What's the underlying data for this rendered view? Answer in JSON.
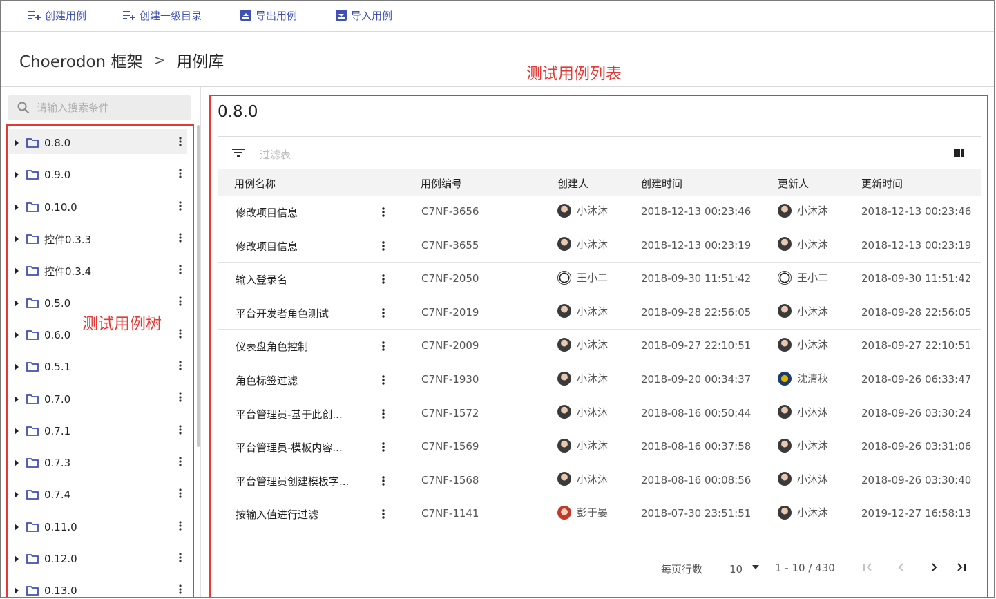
{
  "toolbar": {
    "create_case": "创建用例",
    "create_root_dir": "创建一级目录",
    "export_case": "导出用例",
    "import_case": "导入用例"
  },
  "breadcrumb": {
    "project": "Choerodon 框架",
    "separator": ">",
    "current": "用例库"
  },
  "annotations": {
    "list": "测试用例列表",
    "tree": "测试用例树"
  },
  "search": {
    "placeholder": "请输入搜索条件"
  },
  "tree": {
    "items": [
      {
        "label": "0.8.0",
        "selected": true
      },
      {
        "label": "0.9.0"
      },
      {
        "label": "0.10.0"
      },
      {
        "label": "控件0.3.3"
      },
      {
        "label": "控件0.3.4"
      },
      {
        "label": "0.5.0"
      },
      {
        "label": "0.6.0"
      },
      {
        "label": "0.5.1"
      },
      {
        "label": "0.7.0"
      },
      {
        "label": "0.7.1"
      },
      {
        "label": "0.7.3"
      },
      {
        "label": "0.7.4"
      },
      {
        "label": "0.11.0"
      },
      {
        "label": "0.12.0"
      },
      {
        "label": "0.13.0"
      }
    ]
  },
  "main": {
    "title": "0.8.0",
    "filter_placeholder": "过滤表",
    "columns": [
      "用例名称",
      "用例编号",
      "创建人",
      "创建时间",
      "更新人",
      "更新时间"
    ],
    "rows": [
      {
        "name": "修改项目信息",
        "code": "C7NF-3656",
        "creator": "小沐沐",
        "created": "2018-12-13 00:23:46",
        "updater": "小沐沐",
        "updated": "2018-12-13 00:23:46"
      },
      {
        "name": "修改项目信息",
        "code": "C7NF-3655",
        "creator": "小沐沐",
        "created": "2018-12-13 00:23:19",
        "updater": "小沐沐",
        "updated": "2018-12-13 00:23:19"
      },
      {
        "name": "输入登录名",
        "code": "C7NF-2050",
        "creator": "王小二",
        "created": "2018-09-30 11:51:42",
        "updater": "王小二",
        "updated": "2018-09-30 11:51:42"
      },
      {
        "name": "平台开发者角色测试",
        "code": "C7NF-2019",
        "creator": "小沐沐",
        "created": "2018-09-28 22:56:05",
        "updater": "小沐沐",
        "updated": "2018-09-28 22:56:05"
      },
      {
        "name": "仪表盘角色控制",
        "code": "C7NF-2009",
        "creator": "小沐沐",
        "created": "2018-09-27 22:10:51",
        "updater": "小沐沐",
        "updated": "2018-09-27 22:10:51"
      },
      {
        "name": "角色标签过滤",
        "code": "C7NF-1930",
        "creator": "小沐沐",
        "created": "2018-09-20 00:34:37",
        "updater": "沈清秋",
        "updated": "2018-09-26 06:33:47"
      },
      {
        "name": "平台管理员-基于此创...",
        "code": "C7NF-1572",
        "creator": "小沐沐",
        "created": "2018-08-16 00:50:44",
        "updater": "小沐沐",
        "updated": "2018-09-26 03:30:24"
      },
      {
        "name": "平台管理员-模板内容...",
        "code": "C7NF-1569",
        "creator": "小沐沐",
        "created": "2018-08-16 00:37:58",
        "updater": "小沐沐",
        "updated": "2018-09-26 03:31:06"
      },
      {
        "name": "平台管理员创建模板字...",
        "code": "C7NF-1568",
        "creator": "小沐沐",
        "created": "2018-08-16 00:08:56",
        "updater": "小沐沐",
        "updated": "2018-09-26 03:30:40"
      },
      {
        "name": "按输入值进行过滤",
        "code": "C7NF-1141",
        "creator": "彭于晏",
        "created": "2018-07-30 23:51:51",
        "updater": "小沐沐",
        "updated": "2019-12-27 16:58:13"
      }
    ]
  },
  "pagination": {
    "rows_per_page_label": "每页行数",
    "rows_per_page": "10",
    "range": "1 - 10 / 430"
  },
  "colors": {
    "accent": "#3f51b5",
    "annotation": "#e53935"
  },
  "icons": [
    "add-list-icon",
    "export-icon",
    "import-icon",
    "search-icon",
    "folder-icon",
    "filter-icon",
    "column-icon",
    "more-vert-icon"
  ]
}
